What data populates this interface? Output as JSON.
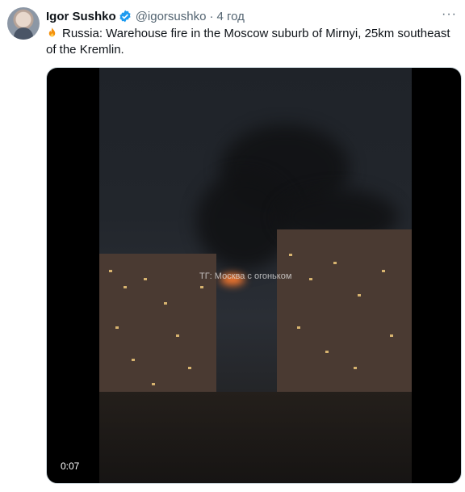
{
  "tweet": {
    "author_name": "Igor Sushko",
    "handle": "@igorsushko",
    "separator": "·",
    "time": "4 год",
    "more_label": "···",
    "text": "Russia: Warehouse fire in the Moscow suburb of Mirnyi, 25km southeast of the Kremlin."
  },
  "media": {
    "watermark": "ТГ: Москва с огоньком",
    "duration": "0:07"
  },
  "colors": {
    "verified_blue": "#1d9bf0",
    "fire_orange": "#ff7b2e"
  },
  "icons": [
    "avatar",
    "verified-badge-icon",
    "fire-emoji-icon",
    "more-icon"
  ]
}
